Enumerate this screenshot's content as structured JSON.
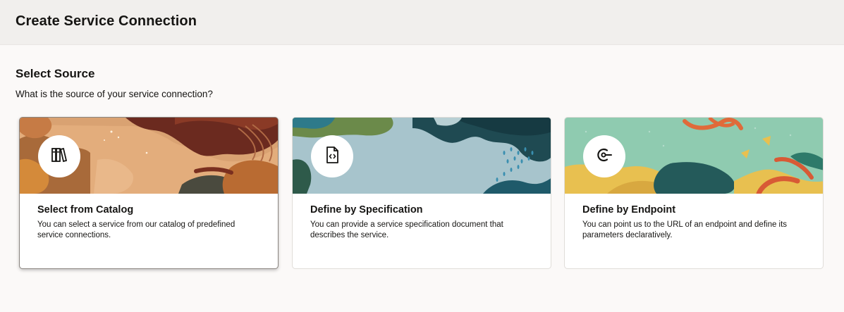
{
  "header": {
    "title": "Create Service Connection"
  },
  "section": {
    "title": "Select Source",
    "subtitle": "What is the source of your service connection?"
  },
  "cards": [
    {
      "title": "Select from Catalog",
      "description": "You can select a service from our catalog of predefined service connections.",
      "icon": "catalog-books-icon",
      "selected": true
    },
    {
      "title": "Define by Specification",
      "description": "You can provide a service specification document that describes the service.",
      "icon": "code-document-icon",
      "selected": false
    },
    {
      "title": "Define by Endpoint",
      "description": "You can point us to the URL of an endpoint and define its parameters declaratively.",
      "icon": "endpoint-icon",
      "selected": false
    }
  ],
  "colors": {
    "header_bg": "#f1efed",
    "page_bg": "#fbf9f8",
    "text": "#161513"
  }
}
